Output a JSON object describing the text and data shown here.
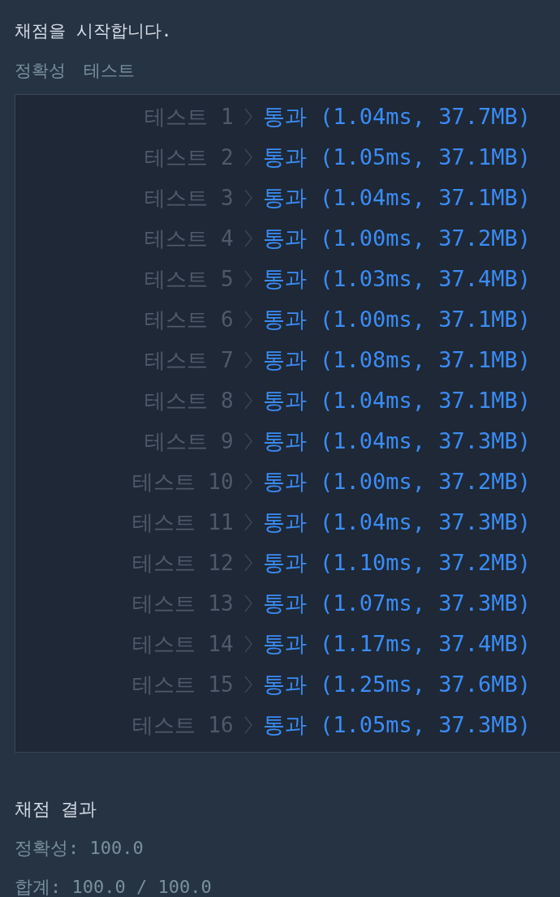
{
  "status_message": "채점을 시작합니다.",
  "section_title": [
    "정확성",
    "테스트"
  ],
  "tests": [
    {
      "label": "테스트 1",
      "result": "통과 (1.04ms, 37.7MB)"
    },
    {
      "label": "테스트 2",
      "result": "통과 (1.05ms, 37.1MB)"
    },
    {
      "label": "테스트 3",
      "result": "통과 (1.04ms, 37.1MB)"
    },
    {
      "label": "테스트 4",
      "result": "통과 (1.00ms, 37.2MB)"
    },
    {
      "label": "테스트 5",
      "result": "통과 (1.03ms, 37.4MB)"
    },
    {
      "label": "테스트 6",
      "result": "통과 (1.00ms, 37.1MB)"
    },
    {
      "label": "테스트 7",
      "result": "통과 (1.08ms, 37.1MB)"
    },
    {
      "label": "테스트 8",
      "result": "통과 (1.04ms, 37.1MB)"
    },
    {
      "label": "테스트 9",
      "result": "통과 (1.04ms, 37.3MB)"
    },
    {
      "label": "테스트 10",
      "result": "통과 (1.00ms, 37.2MB)"
    },
    {
      "label": "테스트 11",
      "result": "통과 (1.04ms, 37.3MB)"
    },
    {
      "label": "테스트 12",
      "result": "통과 (1.10ms, 37.2MB)"
    },
    {
      "label": "테스트 13",
      "result": "통과 (1.07ms, 37.3MB)"
    },
    {
      "label": "테스트 14",
      "result": "통과 (1.17ms, 37.4MB)"
    },
    {
      "label": "테스트 15",
      "result": "통과 (1.25ms, 37.6MB)"
    },
    {
      "label": "테스트 16",
      "result": "통과 (1.05ms, 37.3MB)"
    }
  ],
  "summary": {
    "title": "채점 결과",
    "lines": [
      "정확성: 100.0",
      "합계: 100.0 / 100.0"
    ]
  }
}
